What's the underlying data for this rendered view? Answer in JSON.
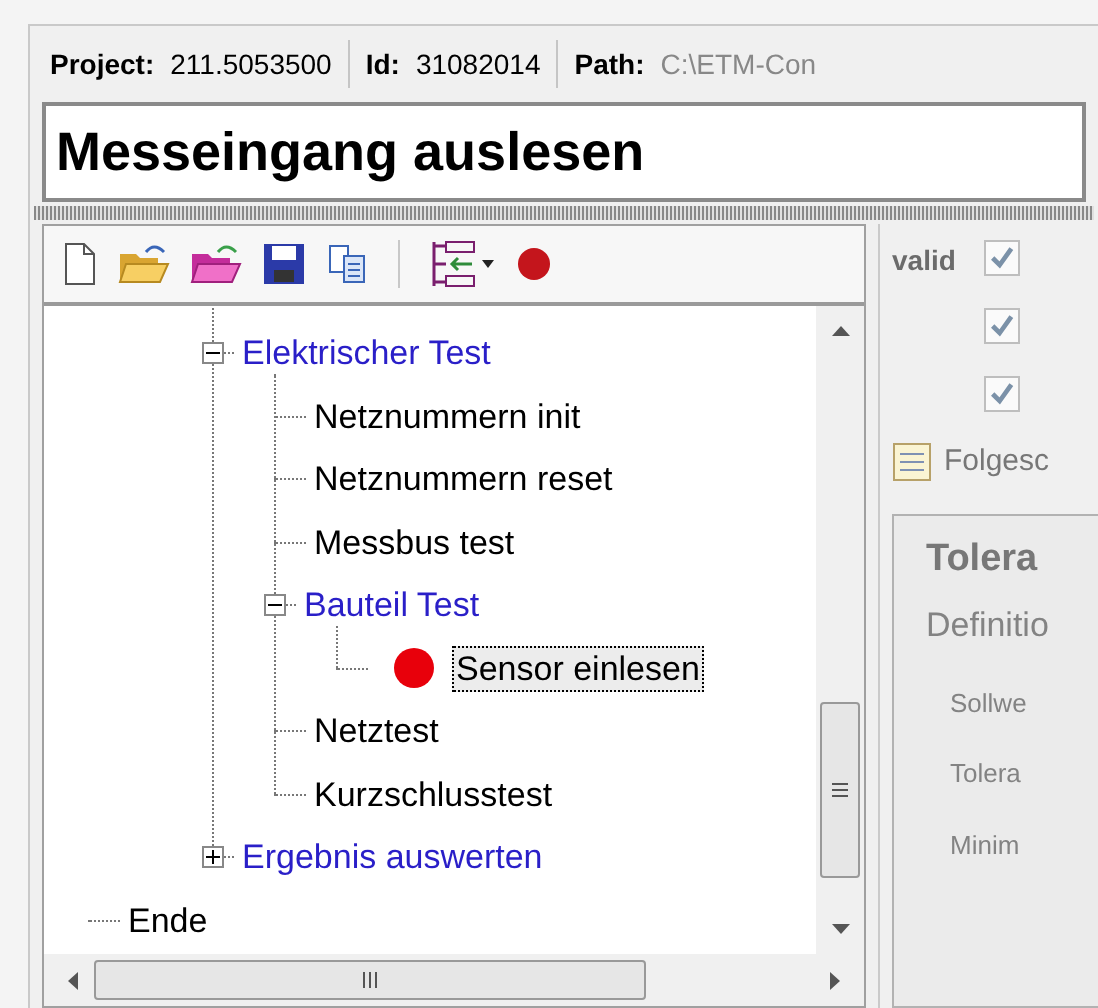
{
  "info_bar": [
    {
      "label": "Project:",
      "value": "211.5053500"
    },
    {
      "label": "Id:",
      "value": "31082014"
    },
    {
      "label": "Path:",
      "value": "C:\\ETM-Con"
    }
  ],
  "title_field": {
    "value": "Messeingang auslesen"
  },
  "toolbar": [
    {
      "kind": "new"
    },
    {
      "kind": "open"
    },
    {
      "kind": "open-pink"
    },
    {
      "kind": "save"
    },
    {
      "kind": "copy"
    },
    {
      "kind": "separator"
    },
    {
      "kind": "tree-menu"
    },
    {
      "kind": "record"
    }
  ],
  "tree": {
    "items": [
      {
        "kind": "hidden",
        "children": [
          {
            "label": "Elektrischer Test",
            "kind": "group",
            "expanded": true,
            "selected": false,
            "children": [
              {
                "label": "Netznummern init",
                "kind": "step",
                "selected": false
              },
              {
                "label": "Netznummern reset",
                "kind": "step",
                "selected": false
              },
              {
                "label": "Messbus test",
                "kind": "step",
                "selected": false
              },
              {
                "label": "Bauteil Test",
                "kind": "group",
                "expanded": true,
                "selected": false,
                "children": [
                  {
                    "label": "Sensor einlesen",
                    "kind": "breakpoint-step",
                    "selected": true
                  }
                ]
              },
              {
                "label": "Netztest",
                "kind": "step",
                "selected": false
              },
              {
                "label": "Kurzschlusstest",
                "kind": "step",
                "selected": false
              }
            ]
          },
          {
            "label": "Ergebnis auswerten",
            "kind": "group",
            "expanded": false,
            "selected": false
          }
        ]
      },
      {
        "label": "Ende",
        "kind": "step",
        "selected": false
      }
    ]
  },
  "right_panel": {
    "valid_label": "valid",
    "checkboxes": [
      {
        "checked": true
      },
      {
        "checked": true
      },
      {
        "checked": true
      }
    ],
    "followup_label": "Folgesc",
    "group_title": "Tolera",
    "group_subtitle": "Definitio",
    "fields": [
      "Sollwe",
      "Tolera",
      "Minim"
    ]
  }
}
